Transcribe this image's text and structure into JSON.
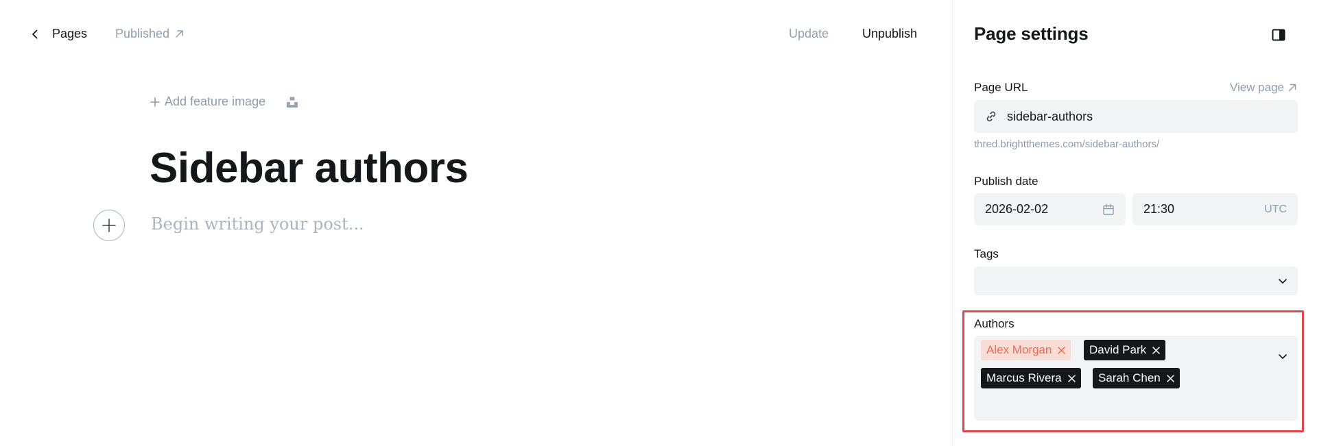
{
  "editor": {
    "back_label": "Pages",
    "status_label": "Published",
    "update_label": "Update",
    "unpublish_label": "Unpublish",
    "add_feature_label": "Add feature image",
    "title": "Sidebar authors",
    "body_placeholder": "Begin writing your post..."
  },
  "settings": {
    "title": "Page settings",
    "page_url": {
      "label": "Page URL",
      "view_page_label": "View page",
      "value": "sidebar-authors",
      "hint": "thred.brightthemes.com/sidebar-authors/"
    },
    "publish_date": {
      "label": "Publish date",
      "date": "2026-02-02",
      "time": "21:30",
      "timezone": "UTC"
    },
    "tags": {
      "label": "Tags",
      "selected": []
    },
    "authors": {
      "label": "Authors",
      "selected": [
        {
          "name": "Alex Morgan",
          "style": "light"
        },
        {
          "name": "David Park",
          "style": "dark"
        },
        {
          "name": "Marcus Rivera",
          "style": "dark"
        },
        {
          "name": "Sarah Chen",
          "style": "dark"
        }
      ]
    }
  },
  "colors": {
    "highlight_border": "#e0474c",
    "chip_dark": "#15171a",
    "chip_light_bg": "#f9dcd5",
    "chip_light_text": "#ef6a50",
    "field_bg": "#f2f3f5",
    "muted_text": "#8e9cac"
  },
  "icons": [
    "chevron-left-icon",
    "external-link-icon",
    "plus-icon",
    "unsplash-icon",
    "plus-circle-icon",
    "sidebar-toggle-icon",
    "link-icon",
    "calendar-icon",
    "chevron-down-icon",
    "close-icon"
  ]
}
